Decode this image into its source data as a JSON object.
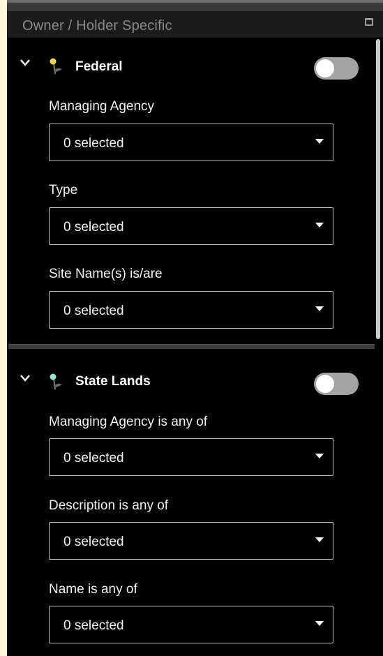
{
  "panel": {
    "title": "Owner / Holder Specific"
  },
  "sections": [
    {
      "title": "Federal",
      "toggle_on": false,
      "fields": [
        {
          "label": "Managing Agency",
          "value": "0 selected"
        },
        {
          "label": "Type",
          "value": "0 selected"
        },
        {
          "label": "Site Name(s) is/are",
          "value": "0 selected"
        }
      ]
    },
    {
      "title": "State Lands",
      "toggle_on": false,
      "fields": [
        {
          "label": "Managing Agency is any of",
          "value": "0 selected"
        },
        {
          "label": "Description is any of",
          "value": "0 selected"
        },
        {
          "label": "Name is any of",
          "value": "0 selected"
        }
      ]
    }
  ],
  "icons": {
    "collapse": "chevron-down-icon",
    "layer": "map-pin-icon",
    "maximize": "maximize-icon",
    "dropdown": "caret-down-icon"
  }
}
